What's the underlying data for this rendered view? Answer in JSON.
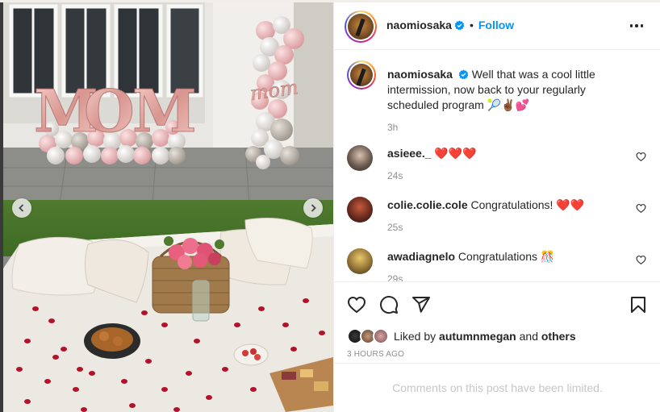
{
  "post": {
    "author": {
      "username": "naomiosaka",
      "verified": true,
      "follow_label": "Follow",
      "separator": "•"
    },
    "caption": {
      "username": "naomiosaka",
      "text": "Well that was a cool little intermission, now back to your regularly scheduled program",
      "emojis": "🎾✌🏾💕",
      "time": "3h"
    },
    "comments": [
      {
        "username": "asieee._",
        "text": "❤️❤️❤️",
        "time": "24s"
      },
      {
        "username": "colie.colie.cole",
        "text": "Congratulations! ❤️❤️",
        "time": "25s"
      },
      {
        "username": "awadiagnelo",
        "text": "Congratulations 🎊",
        "time": "29s"
      }
    ],
    "likes": {
      "prefix": "Liked by",
      "user": "autumnmegan",
      "conjunction": "and",
      "others": "others"
    },
    "posted_ago": "3 HOURS AGO",
    "comments_limited_notice": "Comments on this post have been limited."
  },
  "photo": {
    "balloon_letters": [
      "M",
      "O",
      "M"
    ],
    "balloon_script": "mom"
  },
  "colors": {
    "accent_link": "#0095f6",
    "verified_badge": "#0095f6",
    "text_primary": "#262626",
    "text_secondary": "#8e8e8e",
    "notice_text": "#c7c7c7",
    "heart_red": "#ed4956"
  },
  "icons": {
    "photo_prev": "chevron-left-icon",
    "photo_next": "chevron-right-icon",
    "like": "heart-outline-icon",
    "comment": "speech-bubble-icon",
    "share": "paper-plane-icon",
    "save": "bookmark-icon",
    "menu": "more-horizontal-icon",
    "badge": "verified-badge-icon"
  }
}
